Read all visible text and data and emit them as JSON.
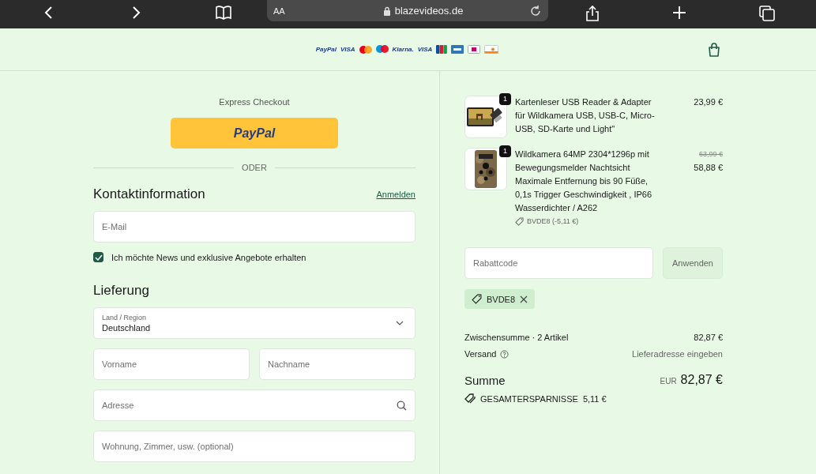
{
  "browser_bar": {
    "text_size_button": "AA",
    "url": "blazevideos.de"
  },
  "header": {
    "payment_methods": [
      {
        "kind": "text",
        "label": "PayPal"
      },
      {
        "kind": "text",
        "label": "VISA"
      },
      {
        "kind": "mastercard"
      },
      {
        "kind": "maestro"
      },
      {
        "kind": "text",
        "label": "Klarna."
      },
      {
        "kind": "text",
        "label": "VISA"
      },
      {
        "kind": "jcb"
      },
      {
        "kind": "amex"
      },
      {
        "kind": "ideal"
      },
      {
        "kind": "discover"
      }
    ]
  },
  "checkout": {
    "express_label": "Express Checkout",
    "paypal_button": "PayPal",
    "divider": "ODER",
    "contact": {
      "title": "Kontaktinformation",
      "login_link": "Anmelden",
      "email_placeholder": "E-Mail",
      "newsletter": {
        "label": "Ich möchte News und exklusive Angebote erhalten",
        "checked": true
      }
    },
    "delivery": {
      "title": "Lieferung",
      "country": {
        "label": "Land / Region",
        "value": "Deutschland"
      },
      "first_name_placeholder": "Vorname",
      "last_name_placeholder": "Nachname",
      "address_placeholder": "Adresse",
      "apartment_placeholder": "Wohnung, Zimmer, usw. (optional)"
    }
  },
  "summary": {
    "items": [
      {
        "kind": "card-reader",
        "quantity": "1",
        "title": "Kartenleser USB Reader & Adapter für Wildkamera USB, USB-C, Micro-USB, SD-Karte und Light\"",
        "price": "23,99 €"
      },
      {
        "kind": "camera",
        "quantity": "1",
        "title": "Wildkamera 64MP 2304*1296p mit Bewegungsmelder Nachtsicht Maximale Entfernung bis 90 Füße, 0,1s Trigger Geschwindigkeit , IP66 Wasserdichter / A262",
        "original_price": "63,99 €",
        "price": "58,88 €",
        "discount": "BVDE8 (-5,11 €)"
      }
    ],
    "discount_placeholder": "Rabattcode",
    "apply_button": "Anwenden",
    "applied_code": "BVDE8",
    "subtotal_label": "Zwischensumme · 2 Artikel",
    "subtotal": "82,87 €",
    "shipping_label": "Versand",
    "shipping_value": "Lieferadresse eingeben",
    "total_label": "Summe",
    "currency": "EUR",
    "total": "82,87 €",
    "savings_label": "GESAMTERSPARNISSE",
    "savings": "5,11 €"
  }
}
